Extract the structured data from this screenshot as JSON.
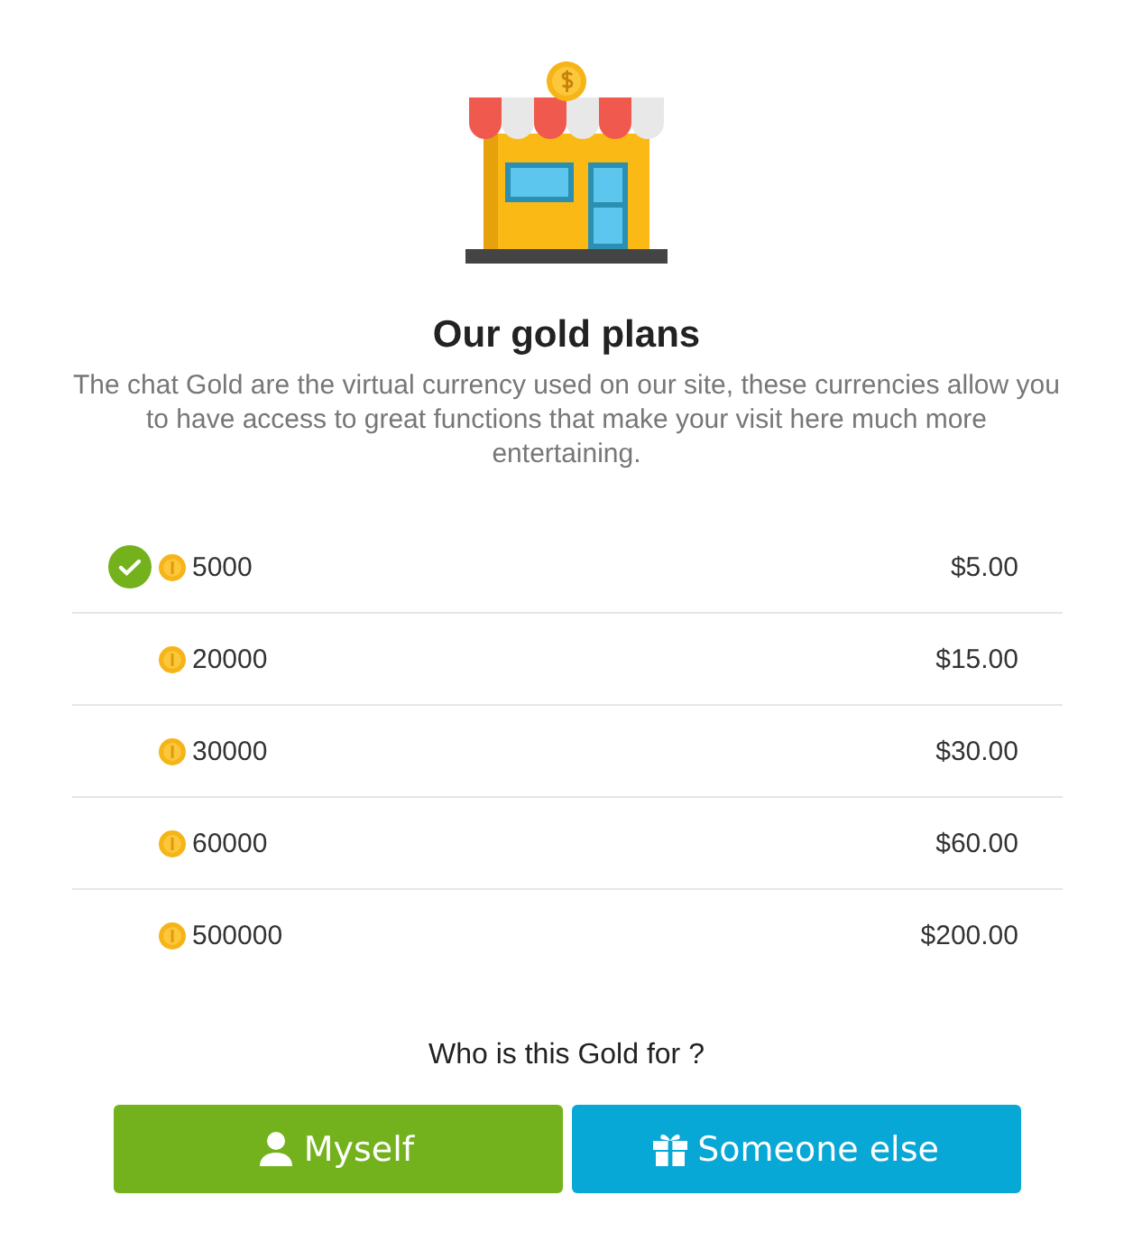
{
  "heading": "Our gold plans",
  "description": "The chat Gold are the virtual currency used on our site, these currencies allow you to have access to great functions that make your visit here much more entertaining.",
  "plans": [
    {
      "amount": "5000",
      "price": "$5.00",
      "selected": true
    },
    {
      "amount": "20000",
      "price": "$15.00",
      "selected": false
    },
    {
      "amount": "30000",
      "price": "$30.00",
      "selected": false
    },
    {
      "amount": "60000",
      "price": "$60.00",
      "selected": false
    },
    {
      "amount": "500000",
      "price": "$200.00",
      "selected": false
    }
  ],
  "question": "Who is this Gold for ?",
  "buttons": [
    {
      "label": "Myself",
      "kind": "self"
    },
    {
      "label": "Someone else",
      "kind": "gift"
    }
  ]
}
